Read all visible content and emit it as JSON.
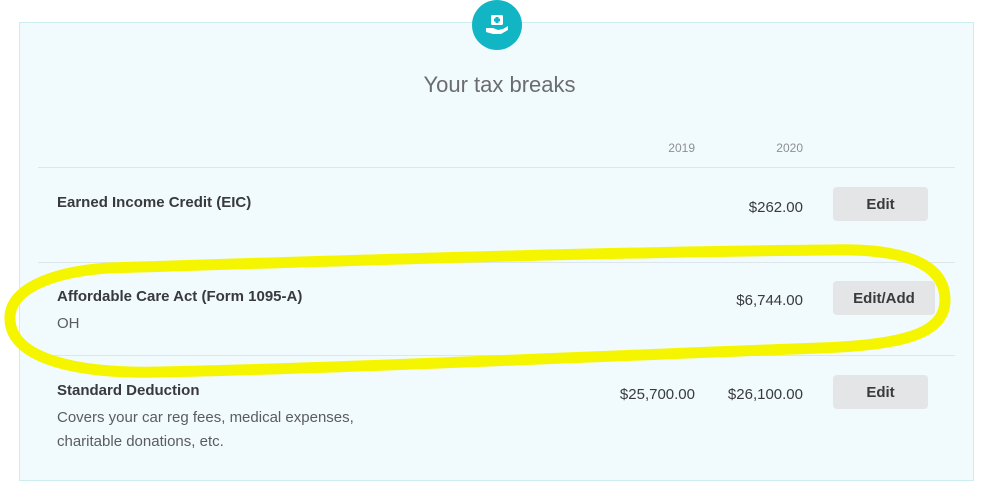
{
  "section": {
    "title": "Your tax breaks",
    "columns": [
      "2019",
      "2020"
    ]
  },
  "rows": [
    {
      "title": "Earned Income Credit (EIC)",
      "subtitle": "",
      "amount_2019": "",
      "amount_2020": "$262.00",
      "button": "Edit"
    },
    {
      "title": "Affordable Care Act (Form 1095-A)",
      "subtitle": "OH",
      "amount_2019": "",
      "amount_2020": "$6,744.00",
      "button": "Edit/Add"
    },
    {
      "title": "Standard Deduction",
      "subtitle_line1": "Covers your car reg fees, medical expenses,",
      "subtitle_line2": "charitable donations, etc.",
      "amount_2019": "$25,700.00",
      "amount_2020": "$26,100.00",
      "button": "Edit"
    }
  ],
  "colors": {
    "accent": "#12b5c3",
    "card_bg": "#f1fafc",
    "highlight": "#f5f500",
    "button_bg": "#e4e5e7"
  },
  "icons": {
    "badge": "hand-receiving-icon"
  }
}
